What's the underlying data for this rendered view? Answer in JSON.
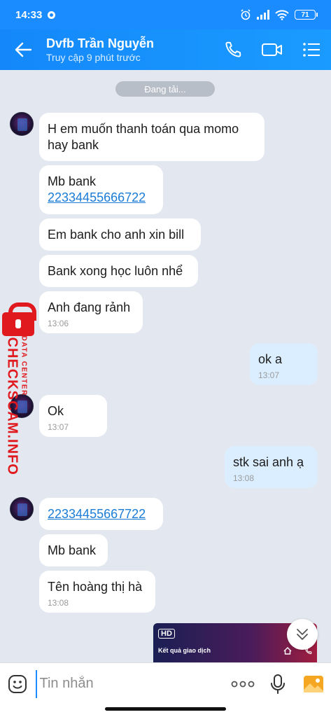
{
  "status_bar": {
    "time": "14:33",
    "battery": "71"
  },
  "header": {
    "title": "Dvfb Trần Nguyễn",
    "subtitle": "Truy cập 9 phút trước"
  },
  "chat": {
    "date_pill": "Đang tải...",
    "messages": [
      {
        "text": "H em muốn thanh toán qua momo hay bank",
        "time": ""
      },
      {
        "text": "Mb bank",
        "link": "22334455666722",
        "time": ""
      },
      {
        "text": "Em bank cho anh xin bill",
        "time": ""
      },
      {
        "text": "Bank xong học luôn nhể",
        "time": ""
      },
      {
        "text": "Anh đang rảnh",
        "time": "13:06"
      },
      {
        "text": "ok a",
        "time": "13:07"
      },
      {
        "text": "Ok",
        "time": "13:07"
      },
      {
        "text": "stk sai anh ạ",
        "time": "13:08"
      },
      {
        "link": "22334455667722",
        "time": ""
      },
      {
        "text": "Mb bank",
        "time": ""
      },
      {
        "text": "Tên hoàng thị hà",
        "time": "13:08"
      }
    ],
    "preview": {
      "badge": "HD",
      "text": "Kết quả giao dịch"
    }
  },
  "watermark": {
    "main": "CHECKSCAM.INFO",
    "sub": "DATA CENTER"
  },
  "composer": {
    "placeholder": "Tin nhắn",
    "more": "ooo"
  },
  "colors": {
    "header": "#1a8cff",
    "incoming": "#ffffff",
    "outgoing": "#dbeeff",
    "link": "#1a7cd6",
    "watermark": "#e0191f"
  }
}
